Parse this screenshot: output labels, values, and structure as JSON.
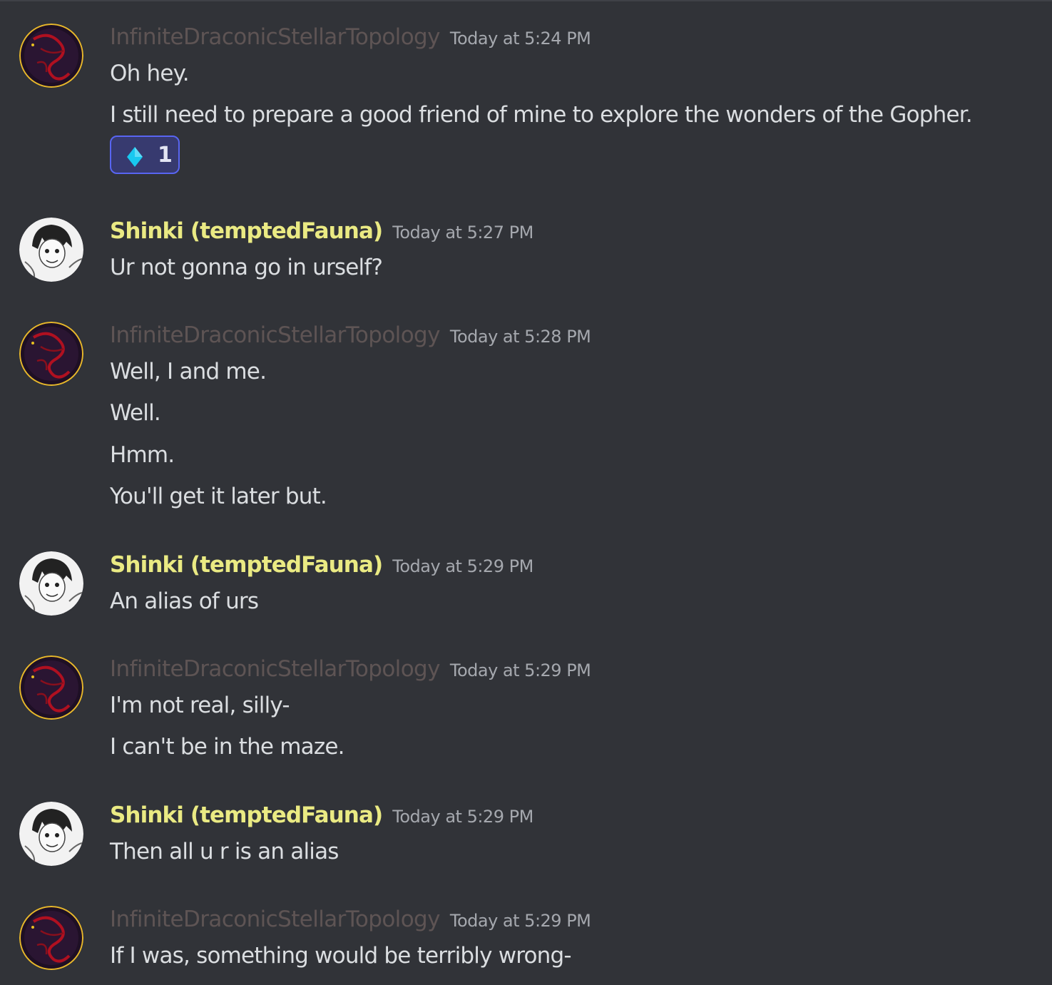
{
  "users": {
    "ids": "InfiniteDraconicStellarTopology",
    "shinki": "Shinki (temptedFauna)"
  },
  "colors": {
    "background": "#313338",
    "ids_name": "#5e5454",
    "shinki_name": "#eaea83",
    "reaction_border": "#5865f2",
    "reaction_gem": "#18c8f0"
  },
  "messages": [
    {
      "author": "InfiniteDraconicStellarTopology",
      "timestamp": "Today at 5:24 PM",
      "lines": [
        "Oh hey.",
        "I still need to prepare a good friend of mine to explore the wonders of the Gopher."
      ],
      "reaction": {
        "icon": "blue-diamond-icon",
        "count": "1"
      }
    },
    {
      "author": "Shinki (temptedFauna)",
      "timestamp": "Today at 5:27 PM",
      "lines": [
        "Ur not gonna go in urself?"
      ]
    },
    {
      "author": "InfiniteDraconicStellarTopology",
      "timestamp": "Today at 5:28 PM",
      "lines": [
        "Well, I and me.",
        "Well.",
        "Hmm.",
        "You'll get it later but."
      ]
    },
    {
      "author": "Shinki (temptedFauna)",
      "timestamp": "Today at 5:29 PM",
      "lines": [
        "An alias of urs"
      ]
    },
    {
      "author": "InfiniteDraconicStellarTopology",
      "timestamp": "Today at 5:29 PM",
      "lines": [
        "I'm not real, silly-",
        "I can't be in the maze."
      ]
    },
    {
      "author": "Shinki (temptedFauna)",
      "timestamp": "Today at 5:29 PM",
      "lines": [
        "Then all u r is an alias"
      ]
    },
    {
      "author": "InfiniteDraconicStellarTopology",
      "timestamp": "Today at 5:29 PM",
      "lines": [
        "If I was, something would be terribly wrong-"
      ]
    }
  ]
}
